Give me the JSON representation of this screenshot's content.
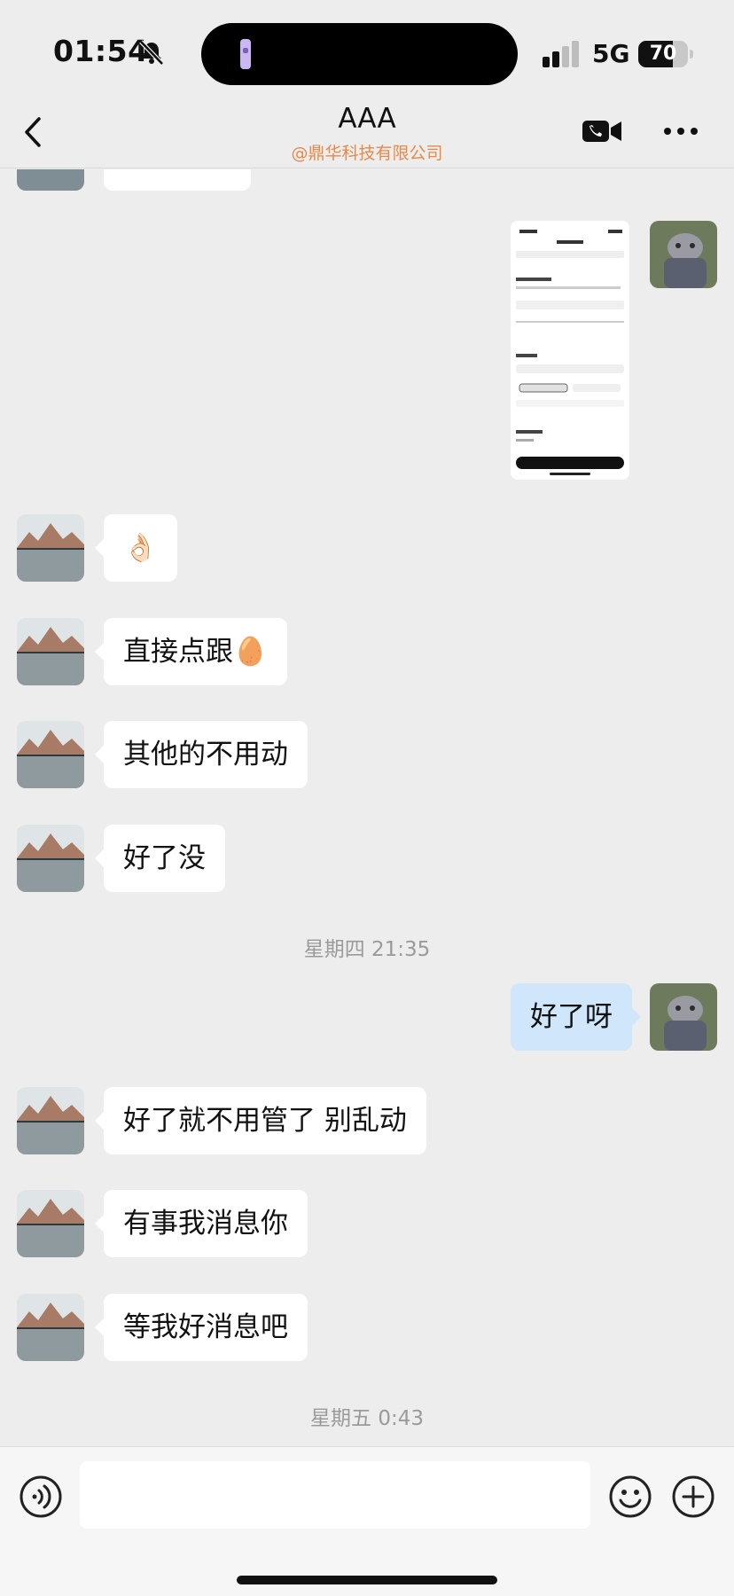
{
  "status_bar": {
    "time": "01:54",
    "network": "5G",
    "battery_percent": "70",
    "battery_level": 0.7
  },
  "header": {
    "title": "AAA",
    "subtitle": "@鼎华科技有限公司"
  },
  "messages": [
    {
      "side": "left",
      "text": "👌🏻"
    },
    {
      "side": "left",
      "text": "直接点跟🥚"
    },
    {
      "side": "left",
      "text": "其他的不用动"
    },
    {
      "side": "left",
      "text": "好了没"
    },
    {
      "side": "right",
      "text": "好了呀"
    },
    {
      "side": "left",
      "text": "好了就不用管了 别乱动"
    },
    {
      "side": "left",
      "text": "有事我消息你"
    },
    {
      "side": "left",
      "text": "等我好消息吧"
    }
  ],
  "timestamps": [
    "星期四 21:35",
    "星期五 0:43"
  ],
  "input": {
    "value": "",
    "placeholder": ""
  },
  "icons": {
    "back": "chevron-left-icon",
    "call": "video-call-icon",
    "more": "more-dots-icon",
    "voice": "voice-icon",
    "emoji": "emoji-icon",
    "plus": "plus-circle-icon"
  },
  "colors": {
    "background": "#ededed",
    "outgoing_bubble": "#cfe6fb",
    "incoming_bubble": "#ffffff",
    "subtitle": "#e8894a"
  }
}
